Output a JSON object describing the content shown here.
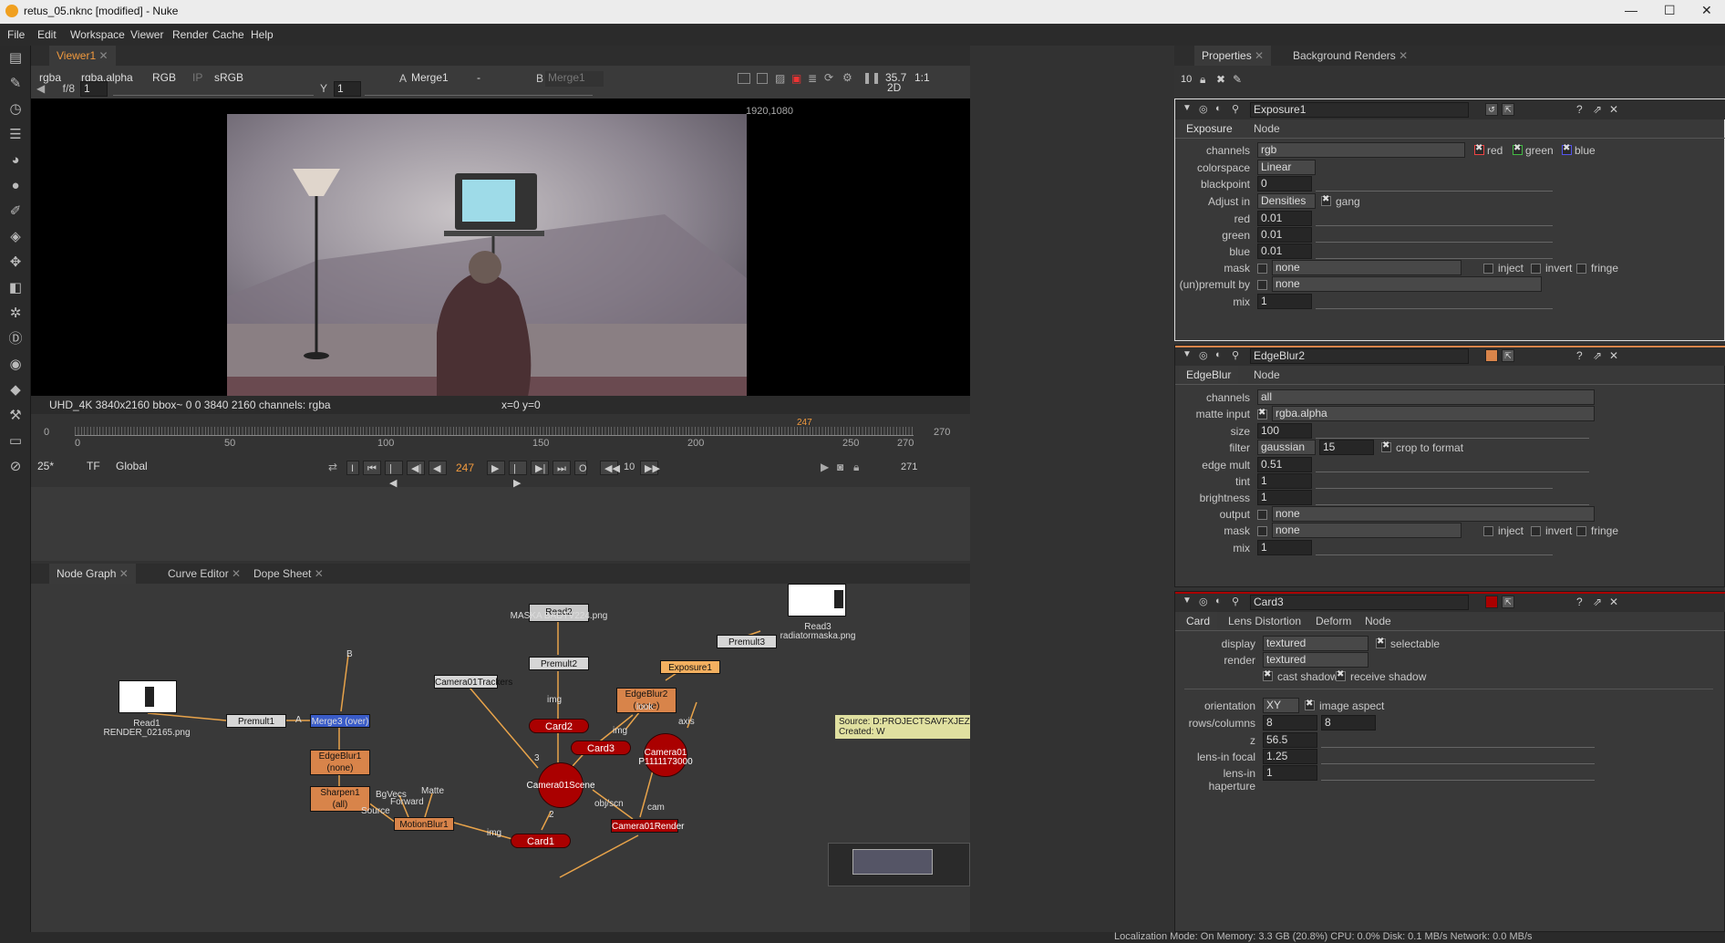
{
  "window": {
    "title": "retus_05.nknc [modified] - Nuke",
    "min": "—",
    "max": "☐",
    "close": "✕"
  },
  "menu": [
    "File",
    "Edit",
    "Workspace",
    "Viewer",
    "Render",
    "Cache",
    "Help"
  ],
  "viewer": {
    "tab": "Viewer1",
    "channels": "rgba",
    "layer": "rgba.alpha",
    "display": "RGB",
    "ip": "IP",
    "lut": "sRGB",
    "inputA_label": "A",
    "inputA": "Merge1",
    "op": "-",
    "inputB_label": "B",
    "inputB": "Merge1",
    "zoom_val": "35.7",
    "ratio": "1:1",
    "mode2d": "2D",
    "fstop": "f/8",
    "gain": "1",
    "y_label": "Y",
    "gamma": "1",
    "format_res": "1920,1080",
    "info": "UHD_4K 3840x2160  bbox~ 0 0 3840 2160 channels: rgba",
    "coords": "x=0 y=0"
  },
  "timeline": {
    "start": "0",
    "end": "270",
    "ticks": [
      "0",
      "50",
      "100",
      "150",
      "200",
      "250",
      "270"
    ],
    "marker": "247",
    "fps": "25*",
    "tf": "TF",
    "global": "Global",
    "frame": "247",
    "step": "10",
    "last": "271"
  },
  "nodegraph": {
    "tabs": [
      "Node Graph",
      "Curve Editor",
      "Dope Sheet"
    ],
    "nodes": {
      "read1": "Read1",
      "read1_file": "RENDER_02165.png",
      "premult1": "Premult1",
      "merge3": "Merge3 (over)",
      "edgeblur1": "EdgeBlur1",
      "edgeblur1_sub": "(none)",
      "sharpen1": "Sharpen1",
      "sharpen1_sub": "(all)",
      "motionblur1": "MotionBlur1",
      "read2": "Read2",
      "read2_file": "MASKA BADTV224.png",
      "premult2": "Premult2",
      "read3": "Read3",
      "read3_file": "radiatormaska.png",
      "premult3": "Premult3",
      "exposure1": "Exposure1",
      "edgeblur2": "EdgeBlur2",
      "edgeblur2_sub": "(none)",
      "trackers": "Camera01Trackers",
      "card2": "Card2",
      "card3": "Card3",
      "card1": "Card1",
      "scene": "Camera01Scene",
      "camera": "Camera01",
      "camera_sub": "P1111173000",
      "render": "Camera01Render"
    },
    "labels": {
      "img1": "img",
      "img2": "img",
      "img3": "img",
      "look": "look",
      "axis": "axis",
      "cam": "cam",
      "objscn": "obj/scn",
      "bgvecs": "BgVecs",
      "forward": "Forward",
      "source": "Source",
      "matte": "Matte",
      "a": "A",
      "b": "B",
      "n3": "3",
      "n2": "2"
    },
    "sticky": "Source: D:PROJECTSAVFXJEZOROT\nCreated: W"
  },
  "properties": {
    "tabs": [
      "Properties",
      "Background Renders"
    ],
    "count": "10",
    "exposure": {
      "name": "Exposure1",
      "tabs": [
        "Exposure",
        "Node"
      ],
      "channels": "rgb",
      "red": "red",
      "green": "green",
      "blue": "blue",
      "colorspace": "Linear",
      "blackpoint": "0",
      "adjust": "Densities",
      "gang": "gang",
      "red_v": "0.01",
      "green_v": "0.01",
      "blue_v": "0.01",
      "mask": "none",
      "inject": "inject",
      "invert": "invert",
      "fringe": "fringe",
      "unpremult": "none",
      "mix": "1",
      "labels": {
        "channels": "channels",
        "colorspace": "colorspace",
        "blackpoint": "blackpoint",
        "adjust": "Adjust in",
        "red": "red",
        "green": "green",
        "blue": "blue",
        "mask": "mask",
        "unpremult": "(un)premult by",
        "mix": "mix"
      }
    },
    "edgeblur": {
      "name": "EdgeBlur2",
      "tabs": [
        "EdgeBlur",
        "Node"
      ],
      "channels": "all",
      "matte": "rgba.alpha",
      "size": "100",
      "filter": "gaussian",
      "filter_v": "15",
      "crop": "crop to format",
      "edgemult": "0.51",
      "tint": "1",
      "brightness": "1",
      "output": "none",
      "mask": "none",
      "inject": "inject",
      "invert": "invert",
      "fringe": "fringe",
      "mix": "1",
      "labels": {
        "channels": "channels",
        "matte": "matte input",
        "size": "size",
        "filter": "filter",
        "edgemult": "edge mult",
        "tint": "tint",
        "brightness": "brightness",
        "output": "output",
        "mask": "mask",
        "mix": "mix"
      }
    },
    "card": {
      "name": "Card3",
      "tabs": [
        "Card",
        "Lens Distortion",
        "Deform",
        "Node"
      ],
      "display": "textured",
      "selectable": "selectable",
      "render": "textured",
      "cast": "cast shadow",
      "receive": "receive shadow",
      "orientation": "XY",
      "image_aspect": "image aspect",
      "rows": "8",
      "cols": "8",
      "z": "56.5",
      "focal": "1.25",
      "haperture": "1",
      "labels": {
        "display": "display",
        "render": "render",
        "orientation": "orientation",
        "rows": "rows/columns",
        "z": "z",
        "focal": "lens-in focal",
        "haperture": "lens-in haperture"
      }
    }
  },
  "status": "Localization Mode: On Memory: 3.3 GB (20.8%) CPU: 0.0% Disk: 0.1 MB/s Network: 0.0 MB/s"
}
